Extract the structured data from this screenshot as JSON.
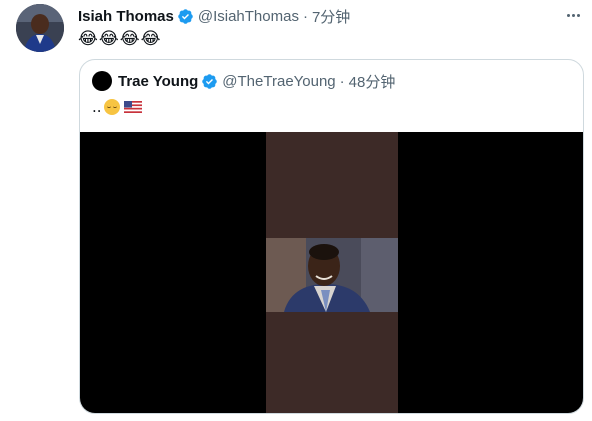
{
  "tweet": {
    "author_name": "Isiah Thomas",
    "author_handle": "@IsiahThomas",
    "separator": "·",
    "time": "7分钟",
    "text": "😂😂😂😂",
    "verified_icon": "verified-badge-icon",
    "more_icon": "more-options-icon"
  },
  "quoted": {
    "author_name": "Trae Young",
    "author_handle": "@TheTraeYoung",
    "separator": "·",
    "time": "48分钟",
    "text_prefix": "..",
    "emojis": [
      "pensive-face",
      "us-flag"
    ],
    "media": "video"
  },
  "colors": {
    "accent": "#1d9bf0",
    "secondary_text": "#536471",
    "border": "#cfd9de",
    "video_strip": "#3d2a27"
  }
}
